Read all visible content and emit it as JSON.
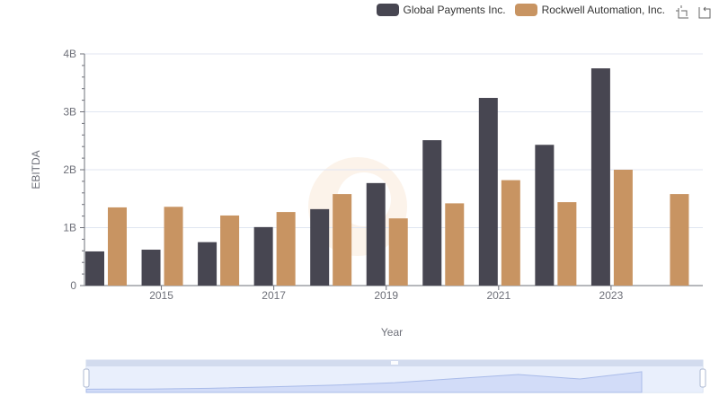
{
  "legend": {
    "items": [
      {
        "label": "Global Payments Inc.",
        "color": "#474651"
      },
      {
        "label": "Rockwell Automation, Inc.",
        "color": "#c89462"
      }
    ]
  },
  "toolbox": {
    "icons": [
      "zoom-icon",
      "restore-icon"
    ]
  },
  "chart_data": {
    "type": "bar",
    "xlabel": "Year",
    "ylabel": "EBITDA",
    "ylim": [
      0,
      4000000000
    ],
    "y_ticks": [
      "0",
      "1B",
      "2B",
      "3B",
      "4B"
    ],
    "x_tick_labels": [
      "2015",
      "2017",
      "2019",
      "2021",
      "2023"
    ],
    "categories": [
      "2014",
      "2015",
      "2016",
      "2017",
      "2018",
      "2019",
      "2020",
      "2021",
      "2022",
      "2023",
      "2024"
    ],
    "series": [
      {
        "name": "Global Payments Inc.",
        "color": "#474651",
        "values": [
          590000000,
          620000000,
          750000000,
          1010000000,
          1320000000,
          1770000000,
          2510000000,
          3240000000,
          2430000000,
          3750000000,
          null
        ]
      },
      {
        "name": "Rockwell Automation, Inc.",
        "color": "#c89462",
        "values": [
          1350000000,
          1360000000,
          1210000000,
          1270000000,
          1580000000,
          1160000000,
          1420000000,
          1820000000,
          1440000000,
          2000000000,
          1580000000
        ]
      }
    ],
    "grid": true,
    "legend_position": "top-right"
  }
}
